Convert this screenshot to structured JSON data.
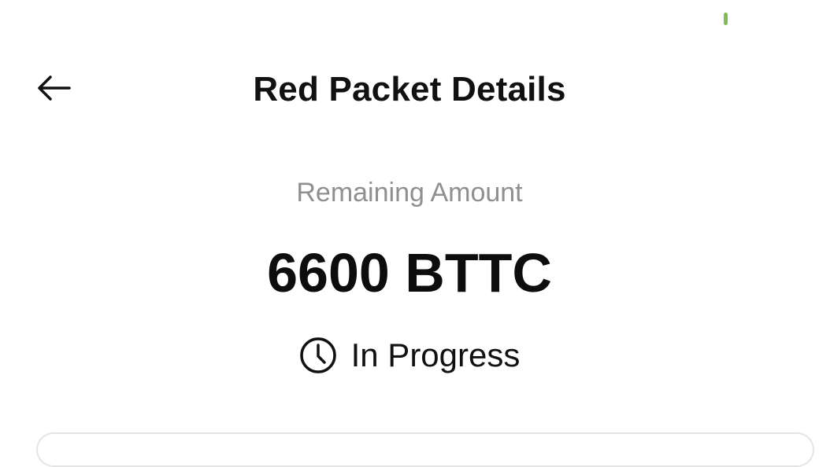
{
  "header": {
    "title": "Red Packet Details",
    "back_icon": "arrow-left-icon"
  },
  "summary": {
    "remaining_label": "Remaining Amount",
    "amount": "6600 BTTC",
    "status": {
      "icon": "clock-icon",
      "label": "In Progress"
    }
  },
  "colors": {
    "status_indicator": "#7cc04f",
    "label_gray": "#8f8f8f",
    "text_dark": "#111111"
  }
}
